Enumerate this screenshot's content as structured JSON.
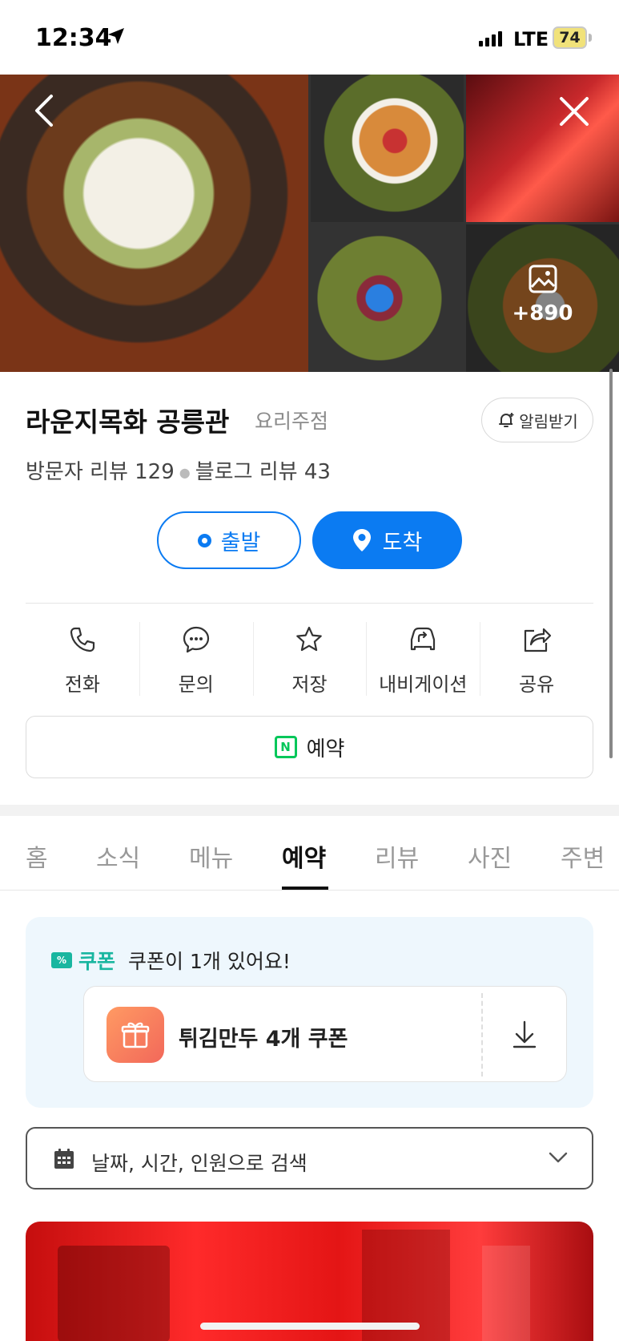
{
  "status_bar": {
    "time": "12:34",
    "network": "LTE",
    "battery": "74"
  },
  "photos": {
    "more_count": "+890"
  },
  "place": {
    "name": "라운지목화 공릉관",
    "category": "요리주점",
    "alarm_label": "알림받기",
    "visitor_reviews": "방문자 리뷰 129",
    "blog_reviews": "블로그 리뷰 43"
  },
  "route": {
    "depart_label": "출발",
    "arrive_label": "도착"
  },
  "actions": [
    {
      "label": "전화",
      "icon": "phone-icon"
    },
    {
      "label": "문의",
      "icon": "chat-icon"
    },
    {
      "label": "저장",
      "icon": "star-icon"
    },
    {
      "label": "내비게이션",
      "icon": "car-nav-icon"
    },
    {
      "label": "공유",
      "icon": "share-icon"
    }
  ],
  "reserve_label": "예약",
  "tabs": [
    "홈",
    "소식",
    "메뉴",
    "예약",
    "리뷰",
    "사진",
    "주변"
  ],
  "active_tab": "예약",
  "coupon": {
    "badge": "쿠폰",
    "message": "쿠폰이 1개 있어요!",
    "item_name": "튀김만두 4개 쿠폰"
  },
  "search": {
    "label": "날짜, 시간, 인원으로 검색"
  },
  "colors": {
    "primary_blue": "#0b7bf2",
    "coupon_teal": "#19b6a0",
    "naver_green": "#03c75a"
  }
}
